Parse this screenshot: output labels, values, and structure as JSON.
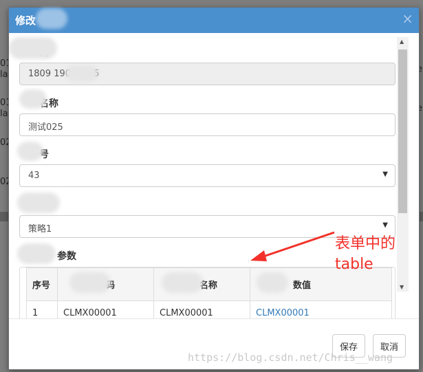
{
  "modal": {
    "title": "修改",
    "close_label": "×"
  },
  "form": {
    "field1": {
      "label": "码",
      "value": "1809 19000925"
    },
    "field2": {
      "label": "名称",
      "value": "测试025"
    },
    "field3": {
      "label": "号",
      "value": "43"
    },
    "field4": {
      "label": "",
      "value": "策略1"
    },
    "field5": {
      "label": "参数"
    }
  },
  "table": {
    "headers": [
      "序号",
      "码",
      "名称",
      "数值"
    ],
    "rows": [
      [
        "1",
        "CLMX00001",
        "CLMX00001",
        "CLMX00001"
      ]
    ]
  },
  "footer": {
    "save_label": "保存",
    "cancel_label": "取消"
  },
  "annotation": {
    "line1": "表单中的",
    "line2": "table",
    "color": "#f2312a"
  },
  "watermark": "https://blog.csdn.net/Chris__wang",
  "background": {
    "snippets": [
      "01",
      "la",
      "01",
      "la",
      "02",
      "02",
      "e",
      "e"
    ]
  },
  "colors": {
    "header": "#4a8fce",
    "link": "#337ab7"
  }
}
